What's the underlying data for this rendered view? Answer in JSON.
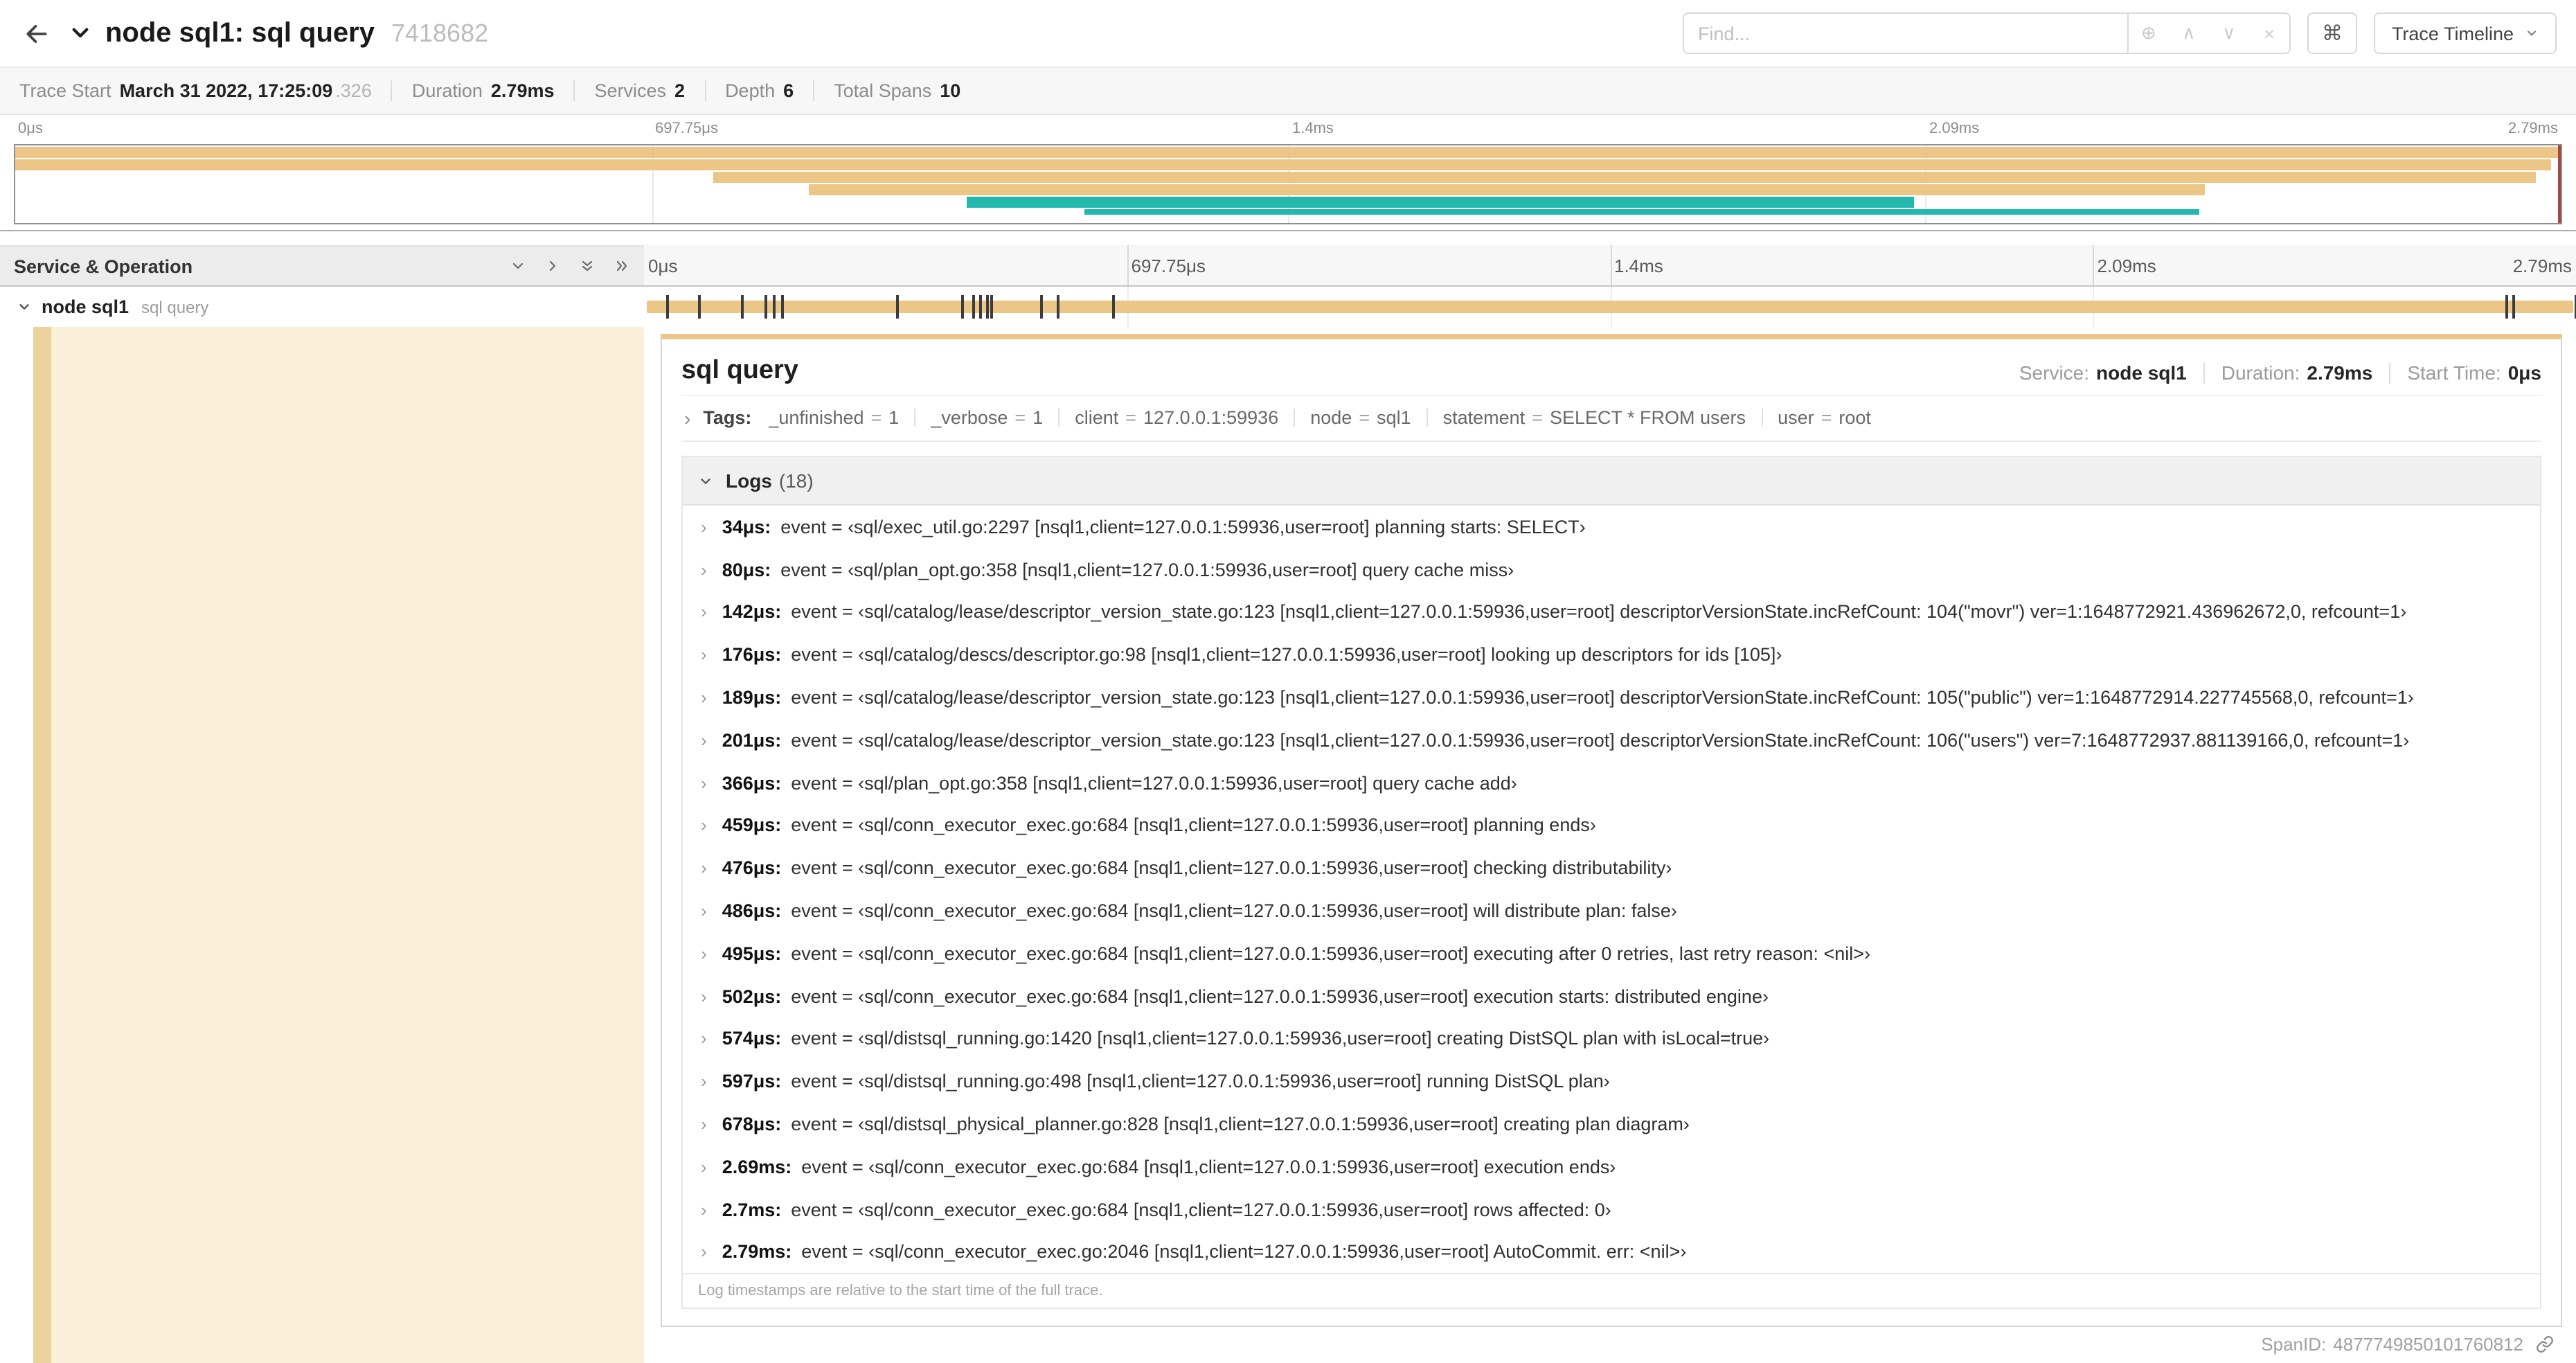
{
  "header": {
    "title": "node sql1: sql query",
    "trace_id": "7418682",
    "find_placeholder": "Find...",
    "shortcut_key": "⌘",
    "view_selector": "Trace Timeline"
  },
  "icons": {
    "focus": "⊕",
    "previous": "∧",
    "next": "∨",
    "clear": "×",
    "chevron_right": "›"
  },
  "summary": {
    "items": [
      {
        "label": "Trace Start",
        "value": "March 31 2022, 17:25:09",
        "value_suffix": ".326"
      },
      {
        "label": "Duration",
        "value": "2.79ms"
      },
      {
        "label": "Services",
        "value": "2"
      },
      {
        "label": "Depth",
        "value": "6"
      },
      {
        "label": "Total Spans",
        "value": "10"
      }
    ]
  },
  "timeline": {
    "ticks": [
      "0μs",
      "697.75μs",
      "1.4ms",
      "2.09ms",
      "2.79ms"
    ],
    "duration_us": 2790,
    "left_header": "Service & Operation",
    "row": {
      "service": "node sql1",
      "operation": "sql query"
    }
  },
  "minimap": {
    "colors": {
      "span": "#ebc687",
      "accent": "#23b8ae",
      "cursor": "#a94442"
    },
    "bars": [
      {
        "row": 0,
        "start": 0,
        "end": 100,
        "color": "span"
      },
      {
        "row": 1,
        "start": 0,
        "end": 25.3,
        "color": "span"
      },
      {
        "row": 1,
        "start": 25.3,
        "end": 99.6,
        "color": "span"
      },
      {
        "row": 2,
        "start": 27.4,
        "end": 99,
        "color": "span"
      },
      {
        "row": 3,
        "start": 31.2,
        "end": 86,
        "color": "span"
      },
      {
        "row": 4,
        "start": 37.4,
        "end": 74.6,
        "color": "accent"
      },
      {
        "row": 5,
        "start": 42,
        "end": 85.8,
        "color": "accent",
        "thin": true
      }
    ]
  },
  "detail": {
    "title": "sql query",
    "meta": [
      {
        "label": "Service:",
        "value": "node sql1"
      },
      {
        "label": "Duration:",
        "value": "2.79ms"
      },
      {
        "label": "Start Time:",
        "value": "0μs"
      }
    ],
    "tags_label": "Tags:",
    "tags": [
      {
        "key": "_unfinished",
        "value": "1"
      },
      {
        "key": "_verbose",
        "value": "1"
      },
      {
        "key": "client",
        "value": "127.0.0.1:59936"
      },
      {
        "key": "node",
        "value": "sql1"
      },
      {
        "key": "statement",
        "value": "SELECT * FROM users"
      },
      {
        "key": "user",
        "value": "root"
      }
    ],
    "logs_label": "Logs",
    "logs_count": "(18)",
    "logs": [
      {
        "t": "34μs:",
        "us": 34,
        "text": "event = ‹sql/exec_util.go:2297 [nsql1,client=127.0.0.1:59936,user=root] planning starts: SELECT›"
      },
      {
        "t": "80μs:",
        "us": 80,
        "text": "event = ‹sql/plan_opt.go:358 [nsql1,client=127.0.0.1:59936,user=root] query cache miss›"
      },
      {
        "t": "142μs:",
        "us": 142,
        "text": "event = ‹sql/catalog/lease/descriptor_version_state.go:123 [nsql1,client=127.0.0.1:59936,user=root] descriptorVersionState.incRefCount: 104(\"movr\") ver=1:1648772921.436962672,0, refcount=1›"
      },
      {
        "t": "176μs:",
        "us": 176,
        "text": "event = ‹sql/catalog/descs/descriptor.go:98 [nsql1,client=127.0.0.1:59936,user=root] looking up descriptors for ids [105]›"
      },
      {
        "t": "189μs:",
        "us": 189,
        "text": "event = ‹sql/catalog/lease/descriptor_version_state.go:123 [nsql1,client=127.0.0.1:59936,user=root] descriptorVersionState.incRefCount: 105(\"public\") ver=1:1648772914.227745568,0, refcount=1›"
      },
      {
        "t": "201μs:",
        "us": 201,
        "text": "event = ‹sql/catalog/lease/descriptor_version_state.go:123 [nsql1,client=127.0.0.1:59936,user=root] descriptorVersionState.incRefCount: 106(\"users\") ver=7:1648772937.881139166,0, refcount=1›"
      },
      {
        "t": "366μs:",
        "us": 366,
        "text": "event = ‹sql/plan_opt.go:358 [nsql1,client=127.0.0.1:59936,user=root] query cache add›"
      },
      {
        "t": "459μs:",
        "us": 459,
        "text": "event = ‹sql/conn_executor_exec.go:684 [nsql1,client=127.0.0.1:59936,user=root] planning ends›"
      },
      {
        "t": "476μs:",
        "us": 476,
        "text": "event = ‹sql/conn_executor_exec.go:684 [nsql1,client=127.0.0.1:59936,user=root] checking distributability›"
      },
      {
        "t": "486μs:",
        "us": 486,
        "text": "event = ‹sql/conn_executor_exec.go:684 [nsql1,client=127.0.0.1:59936,user=root] will distribute plan: false›"
      },
      {
        "t": "495μs:",
        "us": 495,
        "text": "event = ‹sql/conn_executor_exec.go:684 [nsql1,client=127.0.0.1:59936,user=root] executing after 0 retries, last retry reason: <nil>›"
      },
      {
        "t": "502μs:",
        "us": 502,
        "text": "event = ‹sql/conn_executor_exec.go:684 [nsql1,client=127.0.0.1:59936,user=root] execution starts: distributed engine›"
      },
      {
        "t": "574μs:",
        "us": 574,
        "text": "event = ‹sql/distsql_running.go:1420 [nsql1,client=127.0.0.1:59936,user=root] creating DistSQL plan with isLocal=true›"
      },
      {
        "t": "597μs:",
        "us": 597,
        "text": "event = ‹sql/distsql_running.go:498 [nsql1,client=127.0.0.1:59936,user=root] running DistSQL plan›"
      },
      {
        "t": "678μs:",
        "us": 678,
        "text": "event = ‹sql/distsql_physical_planner.go:828 [nsql1,client=127.0.0.1:59936,user=root] creating plan diagram›"
      },
      {
        "t": "2.69ms:",
        "us": 2690,
        "text": "event = ‹sql/conn_executor_exec.go:684 [nsql1,client=127.0.0.1:59936,user=root] execution ends›"
      },
      {
        "t": "2.7ms:",
        "us": 2700,
        "text": "event = ‹sql/conn_executor_exec.go:684 [nsql1,client=127.0.0.1:59936,user=root] rows affected: 0›"
      },
      {
        "t": "2.79ms:",
        "us": 2790,
        "text": "event = ‹sql/conn_executor_exec.go:2046 [nsql1,client=127.0.0.1:59936,user=root] AutoCommit. err: <nil>›"
      }
    ],
    "footer_note": "Log timestamps are relative to the start time of the full trace.",
    "span_id_label": "SpanID:",
    "span_id": "4877749850101760812"
  }
}
